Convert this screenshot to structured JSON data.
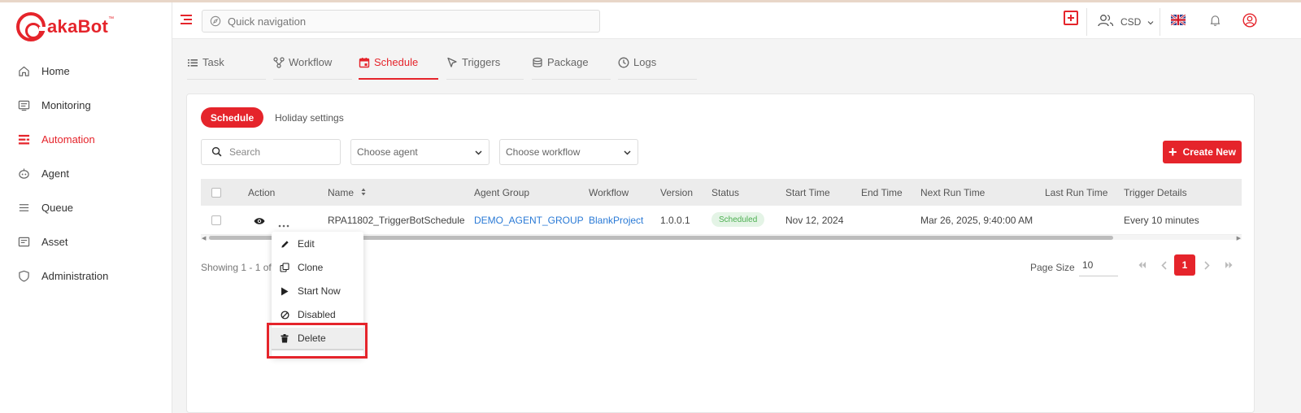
{
  "brand": {
    "name": "akaBot",
    "tm": "™",
    "color": "#e5242b"
  },
  "sidebar": {
    "items": [
      {
        "label": "Home",
        "icon": "home-icon"
      },
      {
        "label": "Monitoring",
        "icon": "monitor-icon"
      },
      {
        "label": "Automation",
        "icon": "automation-icon",
        "active": true
      },
      {
        "label": "Agent",
        "icon": "robot-icon"
      },
      {
        "label": "Queue",
        "icon": "list-icon"
      },
      {
        "label": "Asset",
        "icon": "asset-icon"
      },
      {
        "label": "Administration",
        "icon": "shield-icon"
      }
    ]
  },
  "header": {
    "quick_nav_placeholder": "Quick navigation",
    "org": "CSD",
    "language": "en-GB"
  },
  "tabs": [
    {
      "label": "Task",
      "icon": "list-icon"
    },
    {
      "label": "Workflow",
      "icon": "workflow-icon"
    },
    {
      "label": "Schedule",
      "icon": "calendar-icon",
      "active": true
    },
    {
      "label": "Triggers",
      "icon": "cursor-icon"
    },
    {
      "label": "Package",
      "icon": "database-icon"
    },
    {
      "label": "Logs",
      "icon": "clock-icon"
    }
  ],
  "subtabs": {
    "schedule": "Schedule",
    "holiday": "Holiday settings"
  },
  "filters": {
    "search_placeholder": "Search",
    "agent_placeholder": "Choose agent",
    "workflow_placeholder": "Choose workflow"
  },
  "create_button": "Create New",
  "table": {
    "columns": [
      "Action",
      "Name",
      "Agent Group",
      "Workflow",
      "Version",
      "Status",
      "Start Time",
      "End Time",
      "Next Run Time",
      "Last Run Time",
      "Trigger Details"
    ],
    "rows": [
      {
        "name": "RPA11802_TriggerBotSchedule",
        "agent_group": "DEMO_AGENT_GROUP",
        "workflow": "BlankProject",
        "version": "1.0.0.1",
        "status": "Scheduled",
        "start_time": "Nov 12, 2024",
        "end_time": "",
        "next_run_time": "Mar 26, 2025, 9:40:00 AM",
        "last_run_time": "",
        "trigger_details": "Every 10 minutes"
      }
    ]
  },
  "footer": {
    "showing": "Showing 1 - 1 of 1",
    "page_size_label": "Page Size",
    "page_size": "10",
    "current_page": "1"
  },
  "menu": {
    "items": [
      {
        "label": "Edit",
        "icon": "pencil-icon"
      },
      {
        "label": "Clone",
        "icon": "clone-icon"
      },
      {
        "label": "Start Now",
        "icon": "play-icon"
      },
      {
        "label": "Disabled",
        "icon": "ban-icon"
      },
      {
        "label": "Delete",
        "icon": "trash-icon",
        "highlighted": true
      }
    ]
  }
}
